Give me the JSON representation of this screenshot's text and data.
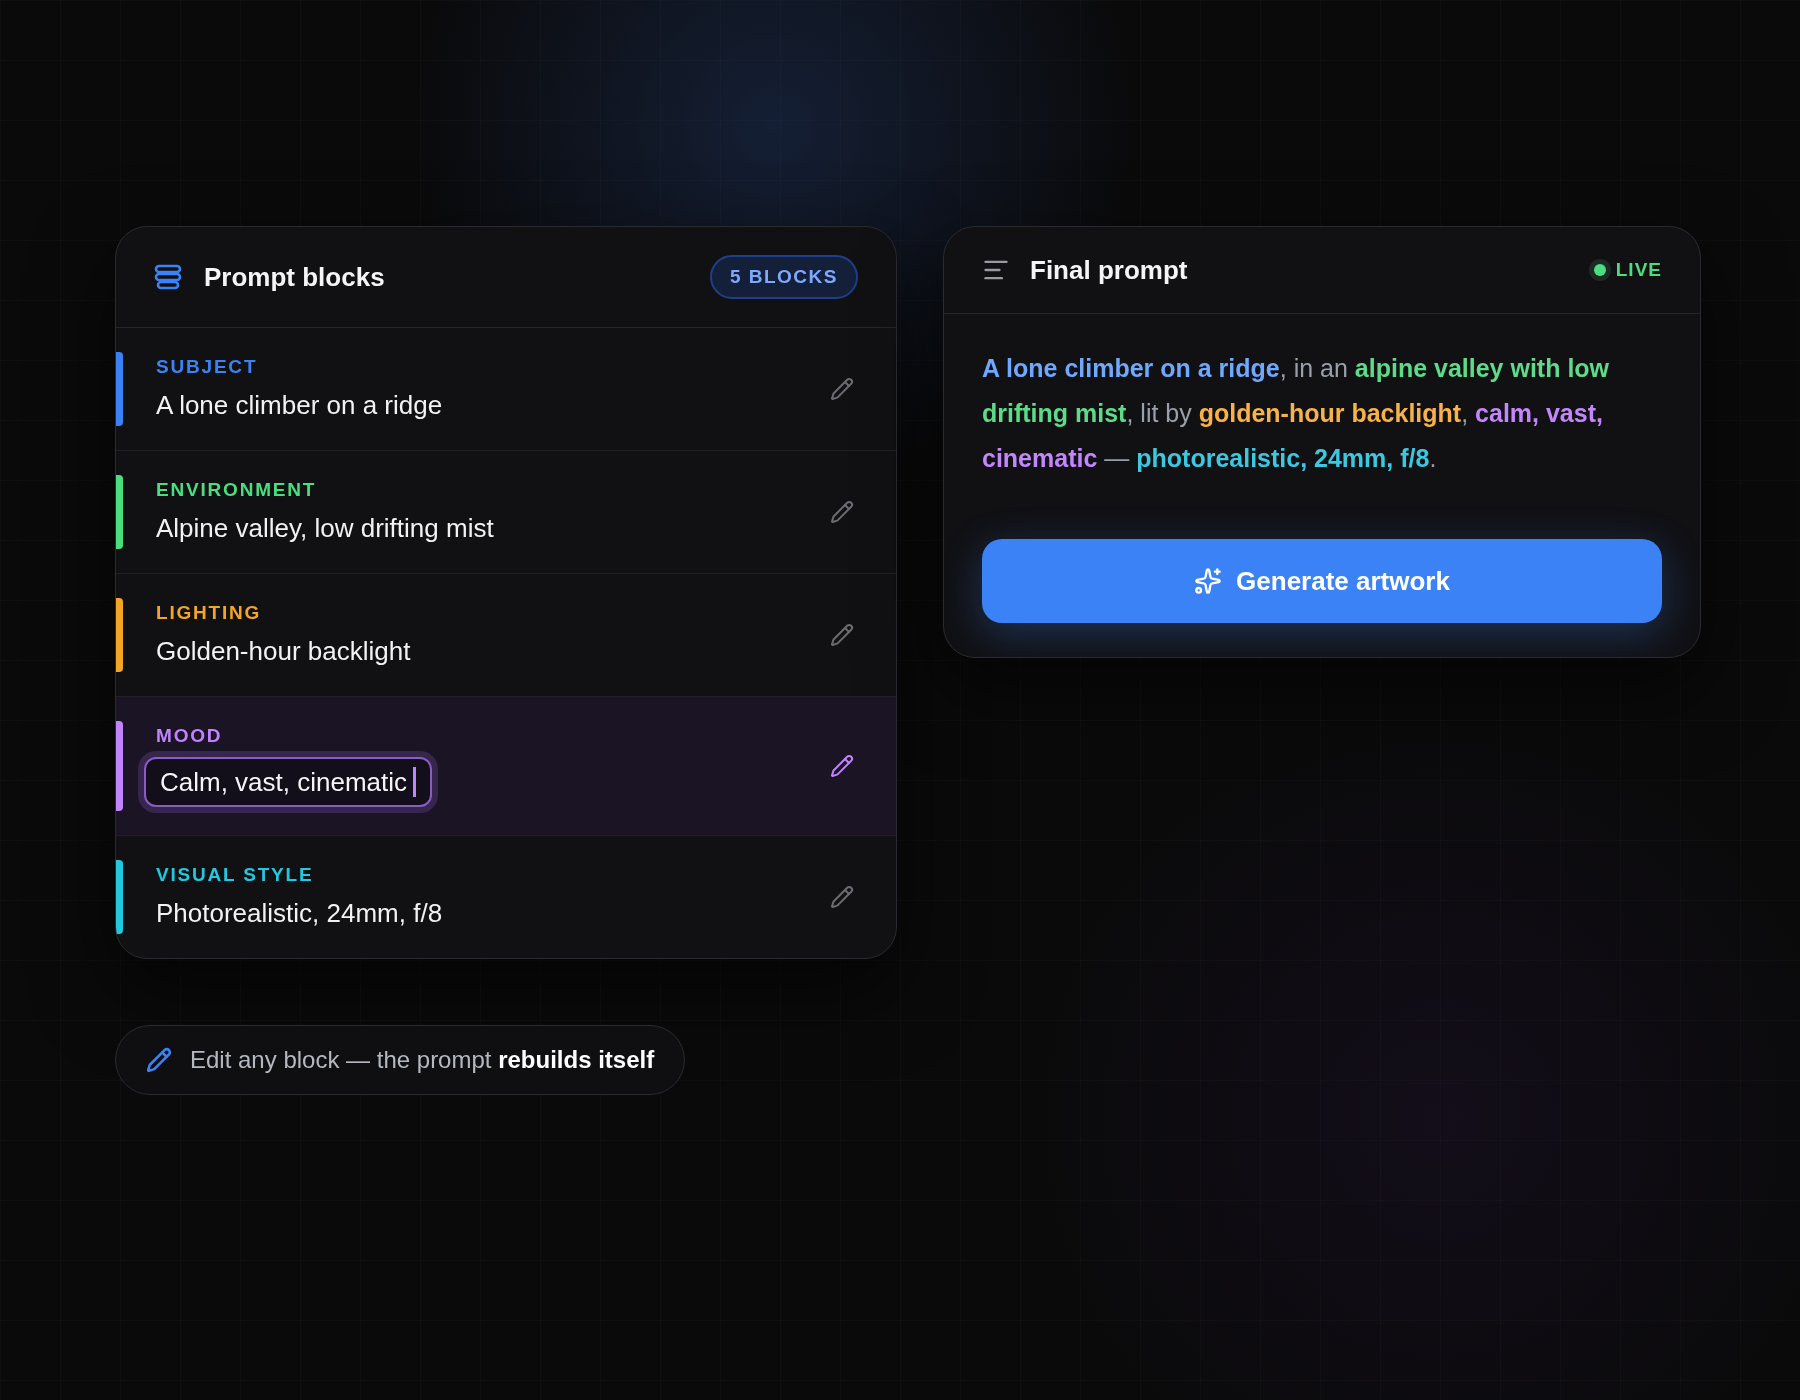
{
  "blocks_panel": {
    "title": "Prompt blocks",
    "count_badge": "5 BLOCKS",
    "blocks": [
      {
        "label": "SUBJECT",
        "value": "A lone climber on a ridge",
        "color": "#3b82f6",
        "selected": false
      },
      {
        "label": "ENVIRONMENT",
        "value": "Alpine valley, low drifting mist",
        "color": "#4ade80",
        "selected": false
      },
      {
        "label": "LIGHTING",
        "value": "Golden-hour backlight",
        "color": "#f5a524",
        "selected": false
      },
      {
        "label": "MOOD",
        "value": "Calm, vast, cinematic",
        "color": "#c084fc",
        "selected": true
      },
      {
        "label": "VISUAL STYLE",
        "value": "Photorealistic, 24mm, f/8",
        "color": "#22c7e0",
        "selected": false
      }
    ]
  },
  "hint": "Edit any block — the prompt **rebuilds itself**",
  "final_panel": {
    "title": "Final prompt",
    "status": {
      "label": "LIVE",
      "on": true
    },
    "segments": [
      {
        "text": "A lone climber on a ridge",
        "color": "#6ea8ff"
      },
      {
        "text": ", in an ",
        "color": "#9aa0ab"
      },
      {
        "text": "alpine valley with low drifting mist",
        "color": "#5ddb8a"
      },
      {
        "text": ", lit by ",
        "color": "#9aa0ab"
      },
      {
        "text": "golden-hour backlight",
        "color": "#f7b24a"
      },
      {
        "text": ", ",
        "color": "#9aa0ab"
      },
      {
        "text": "calm, vast, cinematic",
        "color": "#c287fb"
      },
      {
        "text": " — ",
        "color": "#9aa0ab"
      },
      {
        "text": "photorealistic, 24mm, f/8",
        "color": "#3cc8e0"
      },
      {
        "text": ".",
        "color": "#9aa0ab"
      }
    ],
    "button": "Generate artwork"
  }
}
